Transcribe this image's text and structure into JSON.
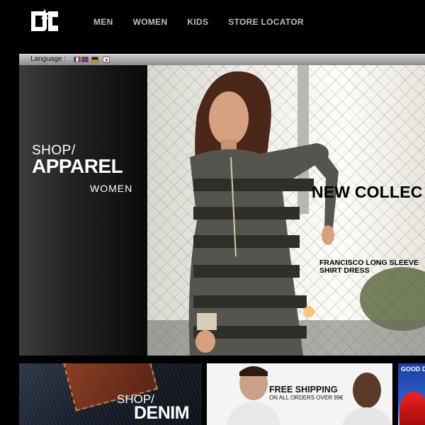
{
  "brand": {
    "logo_text": "DC"
  },
  "nav": {
    "items": [
      "MEN",
      "WOMEN",
      "KIDS",
      "STORE LOCATOR"
    ]
  },
  "language_bar": {
    "label": "Language :",
    "flags": [
      "france-flag-icon",
      "uk-flag-icon",
      "germany-flag-icon",
      "japan-flag-icon"
    ]
  },
  "hero": {
    "shop": "SHOP/",
    "category": "APPAREL",
    "segment": "WOMEN",
    "headline": "NEW COLLEC",
    "product_line1": "FRANCISCO LONG SLEEVE",
    "product_line2": "SHIRT DRESS"
  },
  "promos": {
    "denim": {
      "shop": "SHOP/",
      "title": "DENIM"
    },
    "shipping": {
      "title": "FREE SHIPPING",
      "subtitle": "ON ALL ORDERS OVER 99€"
    },
    "good": {
      "title": "GOOD D"
    }
  },
  "colors": {
    "background": "#000000",
    "nav_text": "#bfbfbf",
    "accent_white": "#ffffff"
  }
}
